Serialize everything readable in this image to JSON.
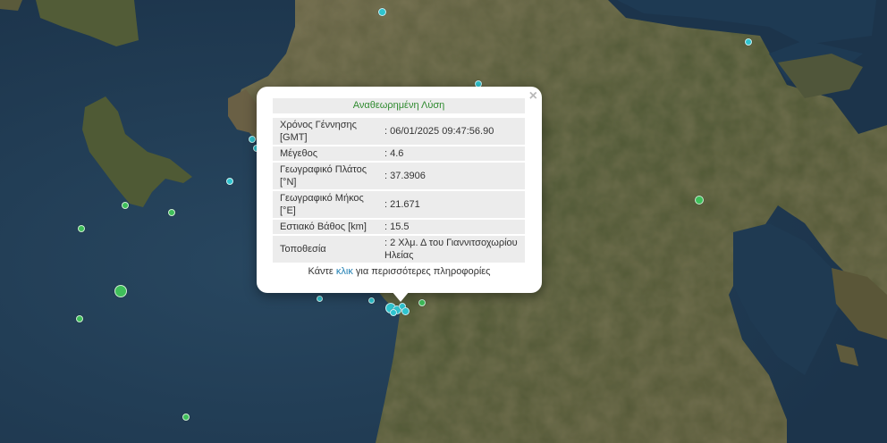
{
  "map": {
    "colors": {
      "sea_deep": "#1e3a53",
      "sea_shallow": "#2b4a63",
      "land_dark": "#3d4a2c",
      "land_mid": "#5e6540",
      "land_light": "#8a7e5e",
      "marker_cyan": "#2ec4cf",
      "marker_green": "#3fbf5a",
      "marker_orange": "#e2642a"
    },
    "markers": [
      {
        "type": "cyan"
      },
      {
        "type": "cyan"
      },
      {
        "type": "cyan"
      },
      {
        "type": "cyan"
      },
      {
        "type": "cyan"
      },
      {
        "type": "cyan"
      },
      {
        "type": "cyan"
      },
      {
        "type": "cyan"
      },
      {
        "type": "green"
      },
      {
        "type": "green"
      },
      {
        "type": "green"
      },
      {
        "type": "green"
      },
      {
        "type": "green"
      },
      {
        "type": "green"
      },
      {
        "type": "green"
      },
      {
        "type": "green"
      },
      {
        "type": "orange"
      }
    ]
  },
  "popup": {
    "title": "Αναθεωρημένη Λύση",
    "close_icon": "×",
    "rows": [
      {
        "label": "Χρόνος Γέννησης [GMT]",
        "value": ": 06/01/2025 09:47:56.90"
      },
      {
        "label": "Μέγεθος",
        "value": ": 4.6"
      },
      {
        "label": "Γεωγραφικό Πλάτος [°N]",
        "value": ": 37.3906"
      },
      {
        "label": "Γεωγραφικό Μήκος [°E]",
        "value": ": 21.671"
      },
      {
        "label": "Εστιακό Βάθος [km]",
        "value": ": 15.5"
      },
      {
        "label": "Τοποθεσία",
        "value": ": 2 Χλμ. Δ του Γιαννιτσοχωρίου Ηλείας"
      }
    ],
    "footer_before": "Κάντε ",
    "footer_link": "κλικ",
    "footer_after": " για περισσότερες πληροφορίες"
  }
}
